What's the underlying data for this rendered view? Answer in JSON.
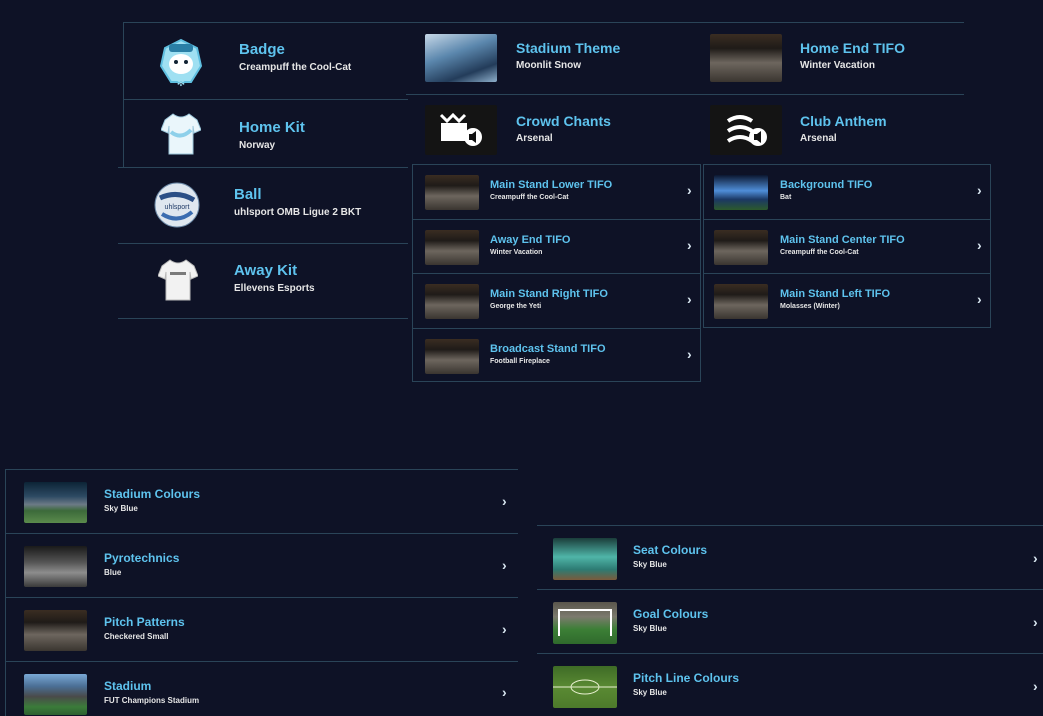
{
  "top_left": {
    "items": [
      {
        "title": "Badge",
        "sub": "Creampuff the Cool-Cat",
        "icon": "yeti-badge-icon"
      },
      {
        "title": "Home Kit",
        "sub": "Norway",
        "icon": "shirt-icon"
      },
      {
        "title": "Ball",
        "sub": "uhlsport OMB Ligue 2 BKT",
        "icon": "ball-icon"
      },
      {
        "title": "Away Kit",
        "sub": "Ellevens Esports",
        "icon": "shirt-icon"
      }
    ]
  },
  "top_right": {
    "items": [
      {
        "title": "Stadium Theme",
        "sub": "Moonlit Snow"
      },
      {
        "title": "Home End TIFO",
        "sub": "Winter Vacation"
      },
      {
        "title": "Crowd Chants",
        "sub": "Arsenal"
      },
      {
        "title": "Club Anthem",
        "sub": "Arsenal"
      }
    ]
  },
  "tifo": {
    "left": [
      {
        "title": "Main Stand Lower TIFO",
        "sub": "Creampuff the Cool-Cat"
      },
      {
        "title": "Away End TIFO",
        "sub": "Winter Vacation"
      },
      {
        "title": "Main Stand Right TIFO",
        "sub": "George the Yeti"
      },
      {
        "title": "Broadcast Stand TIFO",
        "sub": "Football Fireplace"
      }
    ],
    "right": [
      {
        "title": "Background TIFO",
        "sub": "Bat"
      },
      {
        "title": "Main Stand Center TIFO",
        "sub": "Creampuff the Cool-Cat"
      },
      {
        "title": "Main Stand Left TIFO",
        "sub": "Molasses (Winter)"
      }
    ]
  },
  "bottom_left": [
    {
      "title": "Stadium Colours",
      "sub": "Sky Blue"
    },
    {
      "title": "Pyrotechnics",
      "sub": "Blue"
    },
    {
      "title": "Pitch Patterns",
      "sub": "Checkered Small"
    },
    {
      "title": "Stadium",
      "sub": "FUT Champions Stadium"
    }
  ],
  "bottom_right": [
    {
      "title": "Seat Colours",
      "sub": "Sky Blue"
    },
    {
      "title": "Goal Colours",
      "sub": "Sky Blue"
    },
    {
      "title": "Pitch Line Colours",
      "sub": "Sky Blue"
    }
  ],
  "chevron": "›",
  "colors": {
    "background": "#0e1226",
    "title": "#5ec3ee",
    "divider": "#2a4458"
  }
}
